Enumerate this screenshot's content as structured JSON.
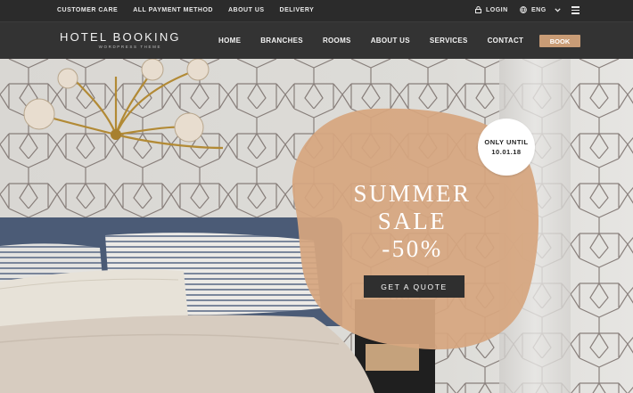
{
  "topbar": {
    "links": [
      "CUSTOMER CARE",
      "ALL PAYMENT METHOD",
      "ABOUT US",
      "DELIVERY"
    ],
    "login_label": "LOGIN",
    "lang_label": "ENG"
  },
  "brand": {
    "title": "HOTEL BOOKING",
    "subtitle": "WORDPRESS THEME"
  },
  "nav": {
    "items": [
      "HOME",
      "BRANCHES",
      "ROOMS",
      "ABOUT US",
      "SERVICES",
      "CONTACT"
    ],
    "book_label": "BOOK"
  },
  "promo": {
    "line1": "SUMMER",
    "line2": "SALE",
    "line3": "-50%",
    "button_label": "GET A QUOTE",
    "badge_line1": "ONLY UNTIL",
    "badge_line2": "10.01.18"
  },
  "colors": {
    "accent": "#c99c76",
    "dark": "#2f2f2f",
    "promo_blob": "#d6a67f"
  },
  "icons": {
    "login": "lock-icon",
    "lang": "globe-icon",
    "lang_dropdown": "chevron-down-icon",
    "menu": "hamburger-icon"
  }
}
